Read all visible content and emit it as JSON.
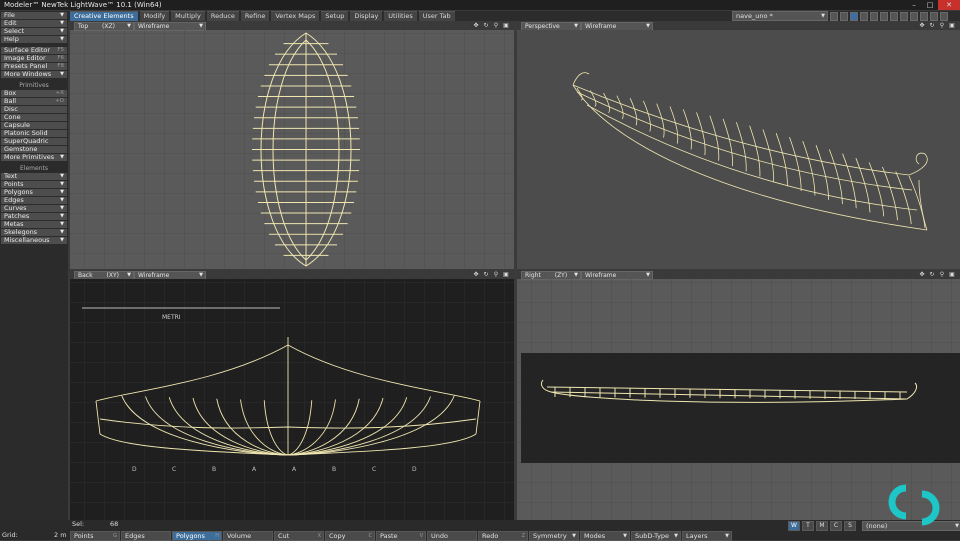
{
  "title": "Modeler™ NewTek LightWave™ 10.1 (Win64)",
  "menus": [
    {
      "label": "File",
      "has_arrow": true
    },
    {
      "label": "Edit",
      "has_arrow": true
    },
    {
      "label": "Select",
      "has_arrow": true
    },
    {
      "label": "Help",
      "has_arrow": true
    }
  ],
  "panels": [
    {
      "label": "Surface Editor",
      "shortcut": "F5"
    },
    {
      "label": "Image Editor",
      "shortcut": "F6"
    },
    {
      "label": "Presets Panel",
      "shortcut": "F8"
    },
    {
      "label": "More Windows",
      "has_arrow": true
    }
  ],
  "primitives_header": "Primitives",
  "primitives": [
    {
      "label": "Box",
      "shortcut": "+X"
    },
    {
      "label": "Ball",
      "shortcut": "+O"
    },
    {
      "label": "Disc"
    },
    {
      "label": "Cone"
    },
    {
      "label": "Capsule"
    },
    {
      "label": "Platonic Solid"
    },
    {
      "label": "SuperQuadric"
    },
    {
      "label": "Gemstone"
    },
    {
      "label": "More Primitives",
      "has_arrow": true
    }
  ],
  "elements_header": "Elements",
  "elements": [
    {
      "label": "Text",
      "has_arrow": true
    },
    {
      "label": "Points",
      "has_arrow": true
    },
    {
      "label": "Polygons",
      "has_arrow": true
    },
    {
      "label": "Edges",
      "has_arrow": true
    },
    {
      "label": "Curves",
      "has_arrow": true
    },
    {
      "label": "Patches",
      "has_arrow": true
    },
    {
      "label": "Metas",
      "has_arrow": true
    },
    {
      "label": "Skelegons",
      "has_arrow": true
    },
    {
      "label": "Miscellaneous",
      "has_arrow": true
    }
  ],
  "tabs": [
    {
      "label": "Creative Elements",
      "active": true
    },
    {
      "label": "Modify"
    },
    {
      "label": "Multiply"
    },
    {
      "label": "Reduce"
    },
    {
      "label": "Refine"
    },
    {
      "label": "Vertex Maps"
    },
    {
      "label": "Setup"
    },
    {
      "label": "Display"
    },
    {
      "label": "Utilities"
    },
    {
      "label": "User Tab"
    }
  ],
  "object_name": "nave_uno *",
  "viewports": {
    "top": {
      "view": "Top",
      "axes": "(XZ)",
      "mode": "Wireframe"
    },
    "perspective": {
      "view": "Perspective",
      "mode": "Wireframe"
    },
    "back": {
      "view": "Back",
      "axes": "(XY)",
      "mode": "Wireframe"
    },
    "right": {
      "view": "Right",
      "axes": "(ZY)",
      "mode": "Wireframe"
    }
  },
  "blueprint": {
    "label": "METRI",
    "stations": [
      "D",
      "C",
      "B",
      "A",
      "A",
      "B",
      "C",
      "D"
    ]
  },
  "status": {
    "sel_label": "Sel:",
    "sel_value": "68",
    "grid_label": "Grid:",
    "grid_value": "2 m"
  },
  "bottom_bar": [
    {
      "label": "Points",
      "shortcut": "G"
    },
    {
      "label": "Edges",
      "shortcut": ""
    },
    {
      "label": "Polygons",
      "shortcut": "H",
      "active": true
    },
    {
      "label": "Volume",
      "shortcut": ""
    },
    {
      "label": "Cut",
      "shortcut": "X"
    },
    {
      "label": "Copy",
      "shortcut": "C"
    },
    {
      "label": "Paste",
      "shortcut": "V"
    },
    {
      "label": "Undo",
      "shortcut": ""
    },
    {
      "label": "Redo",
      "shortcut": "Z"
    },
    {
      "label": "Symmetry",
      "has_arrow": true
    },
    {
      "label": "Modes",
      "has_arrow": true
    },
    {
      "label": "SubD-Type",
      "has_arrow": true
    },
    {
      "label": "Layers",
      "has_arrow": true
    }
  ],
  "wtm_buttons": [
    {
      "label": "W",
      "active": true
    },
    {
      "label": "T"
    },
    {
      "label": "M"
    },
    {
      "label": "C"
    },
    {
      "label": "S"
    }
  ],
  "selection_set": "(none)",
  "colors": {
    "accent": "#3d6d9a",
    "wire": "#efe6b0",
    "close": "#c8302c",
    "logo": "#1fc6c8"
  }
}
